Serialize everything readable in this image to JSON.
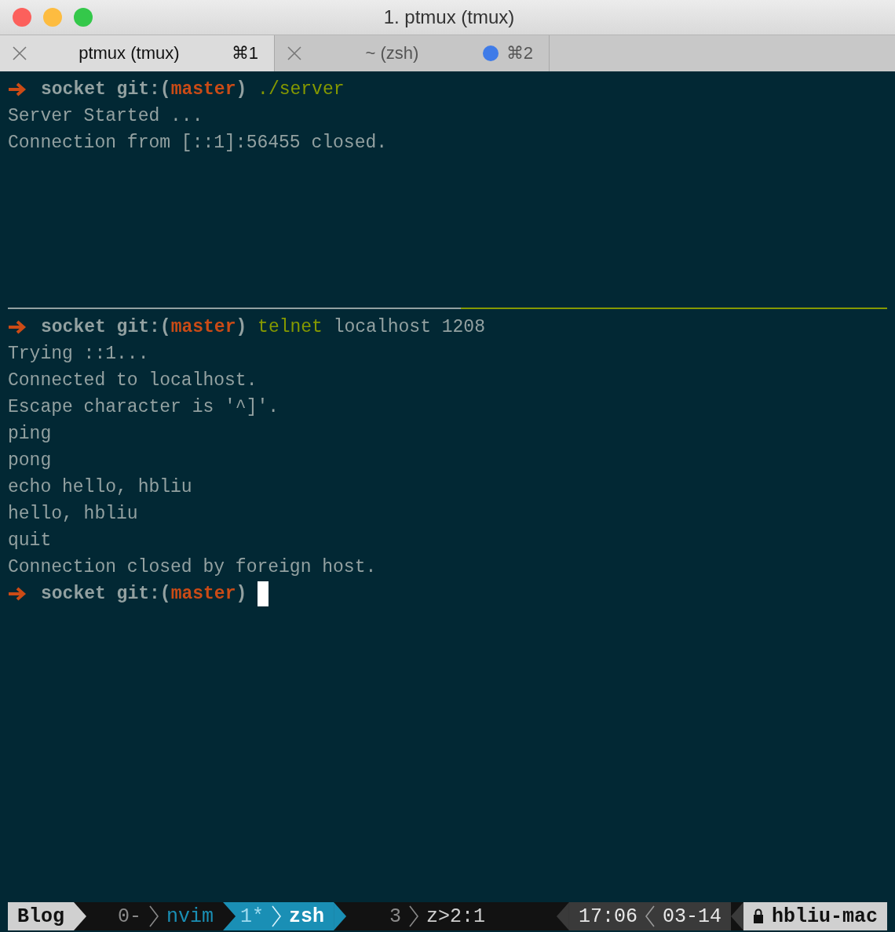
{
  "window": {
    "title": "1. ptmux (tmux)"
  },
  "tabs": [
    {
      "title": "ptmux (tmux)",
      "shortcut": "⌘1",
      "selected": true,
      "activity": false
    },
    {
      "title": "~ (zsh)",
      "shortcut": "⌘2",
      "selected": false,
      "activity": true
    }
  ],
  "panes": [
    {
      "active": false,
      "lines": [
        {
          "segments": [
            {
              "kind": "arrow"
            },
            {
              "kind": "dir",
              "text": "socket git:("
            },
            {
              "kind": "branch",
              "text": "master"
            },
            {
              "kind": "dir",
              "text": ")"
            },
            {
              "kind": "cmd",
              "text": " ./server"
            }
          ]
        },
        {
          "segments": [
            {
              "kind": "text",
              "text": "Server Started ..."
            }
          ]
        },
        {
          "segments": [
            {
              "kind": "text",
              "text": "Connection from [::1]:56455 closed."
            }
          ]
        }
      ]
    },
    {
      "active": true,
      "lines": [
        {
          "segments": [
            {
              "kind": "arrow"
            },
            {
              "kind": "dir",
              "text": "socket git:("
            },
            {
              "kind": "branch",
              "text": "master"
            },
            {
              "kind": "dir",
              "text": ")"
            },
            {
              "kind": "cmd",
              "text": " telnet"
            },
            {
              "kind": "text",
              "text": " localhost 1208"
            }
          ]
        },
        {
          "segments": [
            {
              "kind": "text",
              "text": "Trying ::1..."
            }
          ]
        },
        {
          "segments": [
            {
              "kind": "text",
              "text": "Connected to localhost."
            }
          ]
        },
        {
          "segments": [
            {
              "kind": "text",
              "text": "Escape character is '^]'."
            }
          ]
        },
        {
          "segments": [
            {
              "kind": "text",
              "text": "ping"
            }
          ]
        },
        {
          "segments": [
            {
              "kind": "text",
              "text": "pong"
            }
          ]
        },
        {
          "segments": [
            {
              "kind": "text",
              "text": "echo hello, hbliu"
            }
          ]
        },
        {
          "segments": [
            {
              "kind": "text",
              "text": "hello, hbliu"
            }
          ]
        },
        {
          "segments": [
            {
              "kind": "text",
              "text": "quit"
            }
          ]
        },
        {
          "segments": [
            {
              "kind": "text",
              "text": "Connection closed by foreign host."
            }
          ]
        },
        {
          "segments": [
            {
              "kind": "arrow"
            },
            {
              "kind": "dir",
              "text": "socket git:("
            },
            {
              "kind": "branch",
              "text": "master"
            },
            {
              "kind": "dir",
              "text": ")"
            },
            {
              "kind": "cursor"
            }
          ]
        }
      ]
    }
  ],
  "status_bar": {
    "session": "Blog",
    "windows": [
      {
        "number": "0-",
        "name": "nvim",
        "selected": false
      },
      {
        "number": "1*",
        "name": "zsh",
        "selected": true
      },
      {
        "number": "3",
        "name": "z>2:1",
        "selected": false
      }
    ],
    "time": "17:06",
    "date": "03-14",
    "host": "hbliu-mac"
  }
}
